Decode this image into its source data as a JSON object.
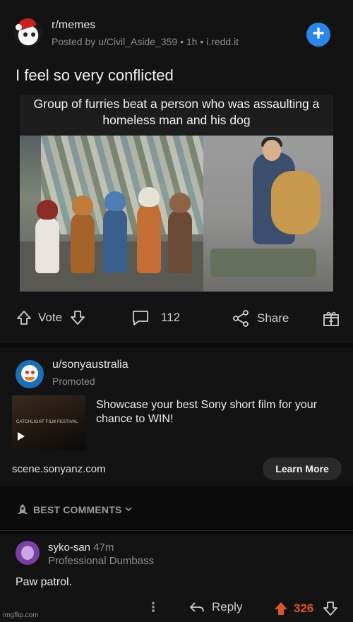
{
  "post": {
    "subreddit": "r/memes",
    "meta": "Posted by u/Civil_Aside_359 • 1h • i.redd.it",
    "title": "I feel so very conflicted",
    "join_icon": "plus-icon",
    "image_caption": "Group of furries beat a person who was assaulting a homeless man and his dog",
    "actions": {
      "vote_label": "Vote",
      "comments_count": "112",
      "share_label": "Share"
    }
  },
  "ad": {
    "user": "u/sonyaustralia",
    "promoted_label": "Promoted",
    "thumbnail_text": "CATCHLIGHT FILM FESTIVAL",
    "headline": "Showcase your best Sony short film for your chance to WIN!",
    "domain": "scene.sonyanz.com",
    "cta": "Learn More"
  },
  "sort": {
    "label": "BEST COMMENTS"
  },
  "comment": {
    "user": "syko-san",
    "time": "47m",
    "flair": "Professional Dumbass",
    "body": "Paw patrol.",
    "more": "⋮",
    "reply_label": "Reply",
    "score": "326"
  },
  "watermark": "imgflip.com",
  "colors": {
    "background": "#0b0b0b",
    "card": "#131313",
    "accent_blue": "#2b86e8",
    "upvote_orange": "#e0542c"
  }
}
